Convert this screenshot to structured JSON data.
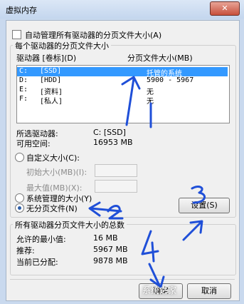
{
  "window": {
    "title": "虚拟内存",
    "close_label": "✕"
  },
  "auto_manage": {
    "label": "自动管理所有驱动器的分页文件大小(A)",
    "checked": false
  },
  "drives_group": {
    "title": "每个驱动器的分页文件大小",
    "col_drive": "驱动器 [卷标](D)",
    "col_size": "分页文件大小(MB)",
    "rows": [
      {
        "drive": "C:",
        "label": "[SSD]",
        "size": "托管的系统",
        "selected": true
      },
      {
        "drive": "D:",
        "label": "[HDD]",
        "size": "5900 - 5967",
        "selected": false
      },
      {
        "drive": "E:",
        "label": "[资料]",
        "size": "无",
        "selected": false
      },
      {
        "drive": "F:",
        "label": "[私人]",
        "size": "无",
        "selected": false
      }
    ],
    "selected_drive_label": "所选驱动器:",
    "selected_drive_value": "C:  [SSD]",
    "free_space_label": "可用空间:",
    "free_space_value": "16953 MB",
    "custom_size_label": "自定义大小(C):",
    "initial_size_label": "初始大小(MB)(I):",
    "max_size_label": "最大值(MB)(X):",
    "system_managed_label": "系统管理的大小(Y)",
    "no_paging_label": "无分页文件(N)",
    "selected_option": "no_paging",
    "set_button": "设置(S)"
  },
  "totals_group": {
    "title": "所有驱动器分页文件大小的总数",
    "min_label": "允许的最小值:",
    "min_value": "16 MB",
    "recommended_label": "推荐:",
    "recommended_value": "5967 MB",
    "current_label": "当前已分配:",
    "current_value": "9878 MB"
  },
  "footer": {
    "ok_label": "确定",
    "cancel_label": "取消"
  },
  "annotations": {
    "color": "#1f4fd8",
    "numbers": [
      "1",
      "2",
      "3",
      "4"
    ]
  },
  "watermark_text": "系统之家"
}
